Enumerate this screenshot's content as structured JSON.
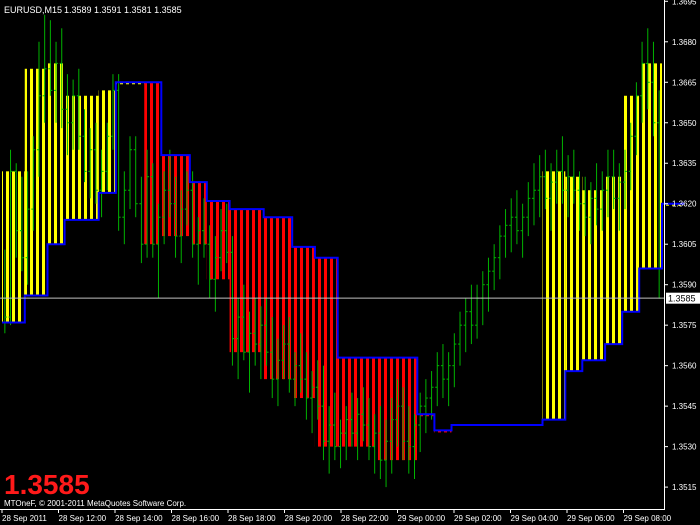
{
  "header": {
    "symbol": "EURUSD,M15",
    "ohlc": "1.3589 1.3591 1.3581 1.3585"
  },
  "big_price": "1.3585",
  "copyright": "MTOneF, © 2001-2011 MetaQuotes Software Corp.",
  "colors": {
    "background": "#000000",
    "bars": "#00b300",
    "stair_line": "#0000ff",
    "up_fill": "#ffff00",
    "down_fill": "#ff0000",
    "price_line": "#c0c0c0",
    "price_label_bg": "#ffffff"
  },
  "chart_data": {
    "type": "ohlc",
    "title": "EURUSD,M15",
    "y_range": [
      1.3508,
      1.3694
    ],
    "y_ticks": [
      "1.3695",
      "1.3680",
      "1.3665",
      "1.3650",
      "1.3635",
      "1.3620",
      "1.3605",
      "1.3590",
      "1.3575",
      "1.3560",
      "1.3545",
      "1.3530",
      "1.3515"
    ],
    "x_labels": [
      "28 Sep 2011",
      "28 Sep 12:00",
      "28 Sep 14:00",
      "28 Sep 16:00",
      "28 Sep 18:00",
      "28 Sep 20:00",
      "28 Sep 22:00",
      "29 Sep 00:00",
      "29 Sep 02:00",
      "29 Sep 04:00",
      "29 Sep 06:00",
      "29 Sep 08:00"
    ],
    "current_price": "1.3585",
    "stair_trend": [
      {
        "i0": 0,
        "i1": 4,
        "level": 1.3576,
        "dir": "up"
      },
      {
        "i0": 4,
        "i1": 8,
        "level": 1.3586,
        "dir": "up"
      },
      {
        "i0": 8,
        "i1": 11,
        "level": 1.3605,
        "dir": "up"
      },
      {
        "i0": 11,
        "i1": 17,
        "level": 1.3614,
        "dir": "up"
      },
      {
        "i0": 17,
        "i1": 20,
        "level": 1.3624,
        "dir": "up"
      },
      {
        "i0": 20,
        "i1": 25,
        "level": 1.3665,
        "dir": "up"
      },
      {
        "i0": 25,
        "i1": 28,
        "level": 1.3665,
        "dir": "down"
      },
      {
        "i0": 28,
        "i1": 33,
        "level": 1.3638,
        "dir": "down"
      },
      {
        "i0": 33,
        "i1": 36,
        "level": 1.3628,
        "dir": "down"
      },
      {
        "i0": 36,
        "i1": 40,
        "level": 1.3621,
        "dir": "down"
      },
      {
        "i0": 40,
        "i1": 46,
        "level": 1.3618,
        "dir": "down"
      },
      {
        "i0": 46,
        "i1": 51,
        "level": 1.3615,
        "dir": "down"
      },
      {
        "i0": 51,
        "i1": 55,
        "level": 1.3604,
        "dir": "down"
      },
      {
        "i0": 55,
        "i1": 59,
        "level": 1.36,
        "dir": "down"
      },
      {
        "i0": 59,
        "i1": 66,
        "level": 1.3563,
        "dir": "down"
      },
      {
        "i0": 66,
        "i1": 73,
        "level": 1.3563,
        "dir": "down"
      },
      {
        "i0": 73,
        "i1": 76,
        "level": 1.3542,
        "dir": "down"
      },
      {
        "i0": 76,
        "i1": 79,
        "level": 1.3536,
        "dir": "down"
      },
      {
        "i0": 79,
        "i1": 95,
        "level": 1.3538,
        "dir": "flat"
      },
      {
        "i0": 95,
        "i1": 99,
        "level": 1.354,
        "dir": "up"
      },
      {
        "i0": 99,
        "i1": 102,
        "level": 1.3558,
        "dir": "up"
      },
      {
        "i0": 102,
        "i1": 106,
        "level": 1.3562,
        "dir": "up"
      },
      {
        "i0": 106,
        "i1": 109,
        "level": 1.3568,
        "dir": "up"
      },
      {
        "i0": 109,
        "i1": 112,
        "level": 1.358,
        "dir": "up"
      },
      {
        "i0": 112,
        "i1": 116,
        "level": 1.3596,
        "dir": "up"
      },
      {
        "i0": 116,
        "i1": 120,
        "level": 1.362,
        "dir": "up"
      }
    ],
    "bars": [
      [
        1.3585,
        1.3603,
        1.3572,
        1.3578
      ],
      [
        1.3578,
        1.364,
        1.3575,
        1.3632
      ],
      [
        1.3632,
        1.3635,
        1.36,
        1.361
      ],
      [
        1.361,
        1.363,
        1.3595,
        1.36
      ],
      [
        1.36,
        1.3632,
        1.359,
        1.3618
      ],
      [
        1.3618,
        1.3645,
        1.361,
        1.364
      ],
      [
        1.364,
        1.368,
        1.363,
        1.366
      ],
      [
        1.366,
        1.369,
        1.365,
        1.367
      ],
      [
        1.367,
        1.3688,
        1.366,
        1.3662
      ],
      [
        1.3662,
        1.368,
        1.365,
        1.3672
      ],
      [
        1.3672,
        1.3685,
        1.3648,
        1.3655
      ],
      [
        1.3655,
        1.3668,
        1.3638,
        1.365
      ],
      [
        1.365,
        1.3666,
        1.364,
        1.366
      ],
      [
        1.366,
        1.367,
        1.364,
        1.3645
      ],
      [
        1.3645,
        1.3655,
        1.3628,
        1.3632
      ],
      [
        1.3632,
        1.3648,
        1.3622,
        1.364
      ],
      [
        1.364,
        1.365,
        1.362,
        1.3625
      ],
      [
        1.3625,
        1.364,
        1.3615,
        1.3632
      ],
      [
        1.3632,
        1.365,
        1.3625,
        1.3645
      ],
      [
        1.3645,
        1.3668,
        1.364,
        1.3662
      ],
      [
        1.3662,
        1.3668,
        1.361,
        1.3615
      ],
      [
        1.3615,
        1.3632,
        1.3605,
        1.3625
      ],
      [
        1.3625,
        1.3645,
        1.3618,
        1.364
      ],
      [
        1.364,
        1.3645,
        1.3615,
        1.362
      ],
      [
        1.362,
        1.363,
        1.3598,
        1.3605
      ],
      [
        1.3605,
        1.364,
        1.36,
        1.363
      ],
      [
        1.363,
        1.3635,
        1.36,
        1.3605
      ],
      [
        1.3605,
        1.362,
        1.3585,
        1.3615
      ],
      [
        1.3615,
        1.3632,
        1.3605,
        1.3625
      ],
      [
        1.3625,
        1.364,
        1.3615,
        1.362
      ],
      [
        1.362,
        1.363,
        1.36,
        1.3608
      ],
      [
        1.3608,
        1.3625,
        1.3598,
        1.3618
      ],
      [
        1.3618,
        1.3632,
        1.3612,
        1.3625
      ],
      [
        1.3625,
        1.3632,
        1.36,
        1.3605
      ],
      [
        1.3605,
        1.3615,
        1.359,
        1.361
      ],
      [
        1.361,
        1.3622,
        1.36,
        1.3605
      ],
      [
        1.3605,
        1.3612,
        1.3585,
        1.3592
      ],
      [
        1.3592,
        1.3608,
        1.358,
        1.36
      ],
      [
        1.36,
        1.3618,
        1.3595,
        1.361
      ],
      [
        1.361,
        1.362,
        1.3598,
        1.3602
      ],
      [
        1.3602,
        1.3608,
        1.356,
        1.357
      ],
      [
        1.357,
        1.3585,
        1.3555,
        1.3578
      ],
      [
        1.3578,
        1.359,
        1.3562,
        1.3565
      ],
      [
        1.3565,
        1.358,
        1.355,
        1.3572
      ],
      [
        1.3572,
        1.3585,
        1.356,
        1.3568
      ],
      [
        1.3568,
        1.3582,
        1.3555,
        1.3575
      ],
      [
        1.3575,
        1.3585,
        1.356,
        1.3565
      ],
      [
        1.3565,
        1.3578,
        1.3548,
        1.3555
      ],
      [
        1.3555,
        1.357,
        1.3545,
        1.3562
      ],
      [
        1.3562,
        1.3575,
        1.3555,
        1.3568
      ],
      [
        1.3568,
        1.3578,
        1.355,
        1.3555
      ],
      [
        1.3555,
        1.3565,
        1.3545,
        1.356
      ],
      [
        1.356,
        1.3572,
        1.355,
        1.3555
      ],
      [
        1.3555,
        1.3565,
        1.354,
        1.3548
      ],
      [
        1.3548,
        1.3558,
        1.3535,
        1.3552
      ],
      [
        1.3552,
        1.3562,
        1.354,
        1.3545
      ],
      [
        1.3545,
        1.356,
        1.3525,
        1.3532
      ],
      [
        1.3532,
        1.3545,
        1.352,
        1.3538
      ],
      [
        1.3538,
        1.355,
        1.3525,
        1.353
      ],
      [
        1.353,
        1.354,
        1.3522,
        1.3535
      ],
      [
        1.3535,
        1.3545,
        1.3525,
        1.354
      ],
      [
        1.354,
        1.355,
        1.353,
        1.3535
      ],
      [
        1.3535,
        1.3548,
        1.3525,
        1.3542
      ],
      [
        1.3542,
        1.3552,
        1.3532,
        1.3538
      ],
      [
        1.3538,
        1.3548,
        1.3525,
        1.353
      ],
      [
        1.353,
        1.3542,
        1.352,
        1.3535
      ],
      [
        1.3535,
        1.3545,
        1.3518,
        1.3525
      ],
      [
        1.3525,
        1.354,
        1.3515,
        1.3532
      ],
      [
        1.3532,
        1.3548,
        1.352,
        1.354
      ],
      [
        1.354,
        1.3555,
        1.353,
        1.3545
      ],
      [
        1.3545,
        1.3552,
        1.3525,
        1.3532
      ],
      [
        1.3532,
        1.3545,
        1.352,
        1.353
      ],
      [
        1.353,
        1.3542,
        1.3518,
        1.3538
      ],
      [
        1.3538,
        1.355,
        1.3528,
        1.3545
      ],
      [
        1.3545,
        1.3555,
        1.3535,
        1.3548
      ],
      [
        1.3548,
        1.3558,
        1.354,
        1.3552
      ],
      [
        1.3552,
        1.3565,
        1.3545,
        1.356
      ],
      [
        1.356,
        1.3568,
        1.3548,
        1.3555
      ],
      [
        1.3555,
        1.3565,
        1.3545,
        1.356
      ],
      [
        1.356,
        1.3572,
        1.3552,
        1.3568
      ],
      [
        1.3568,
        1.358,
        1.356,
        1.3575
      ],
      [
        1.3575,
        1.3585,
        1.3565,
        1.358
      ],
      [
        1.358,
        1.359,
        1.3568,
        1.3575
      ],
      [
        1.3575,
        1.359,
        1.357,
        1.3585
      ],
      [
        1.3585,
        1.3595,
        1.3575,
        1.359
      ],
      [
        1.359,
        1.36,
        1.358,
        1.3595
      ],
      [
        1.3595,
        1.3605,
        1.3588,
        1.36
      ],
      [
        1.36,
        1.3612,
        1.3592,
        1.3608
      ],
      [
        1.3608,
        1.3618,
        1.36,
        1.3612
      ],
      [
        1.3612,
        1.3622,
        1.3602,
        1.3615
      ],
      [
        1.3615,
        1.3625,
        1.3605,
        1.361
      ],
      [
        1.361,
        1.362,
        1.36,
        1.3615
      ],
      [
        1.3615,
        1.3628,
        1.3608,
        1.3622
      ],
      [
        1.3622,
        1.3635,
        1.3612,
        1.3625
      ],
      [
        1.3625,
        1.3638,
        1.3615,
        1.363
      ],
      [
        1.363,
        1.364,
        1.3618,
        1.3622
      ],
      [
        1.3622,
        1.3635,
        1.361,
        1.3628
      ],
      [
        1.3628,
        1.364,
        1.362,
        1.3632
      ],
      [
        1.3632,
        1.3645,
        1.362,
        1.3625
      ],
      [
        1.3625,
        1.3638,
        1.3615,
        1.363
      ],
      [
        1.363,
        1.364,
        1.362,
        1.3625
      ],
      [
        1.3625,
        1.3632,
        1.361,
        1.362
      ],
      [
        1.362,
        1.363,
        1.3608,
        1.3615
      ],
      [
        1.3615,
        1.3628,
        1.3605,
        1.3622
      ],
      [
        1.3622,
        1.3635,
        1.3612,
        1.3618
      ],
      [
        1.3618,
        1.3632,
        1.361,
        1.3625
      ],
      [
        1.3625,
        1.364,
        1.3615,
        1.363
      ],
      [
        1.363,
        1.364,
        1.3618,
        1.3622
      ],
      [
        1.3622,
        1.3635,
        1.361,
        1.3628
      ],
      [
        1.3628,
        1.364,
        1.3618,
        1.3632
      ],
      [
        1.3632,
        1.365,
        1.3625,
        1.3645
      ],
      [
        1.3645,
        1.3665,
        1.3638,
        1.366
      ],
      [
        1.366,
        1.368,
        1.365,
        1.3672
      ],
      [
        1.3672,
        1.3685,
        1.3655,
        1.3665
      ],
      [
        1.3665,
        1.368,
        1.3645,
        1.365
      ],
      [
        1.365,
        1.3662,
        1.3585,
        1.3585
      ]
    ]
  }
}
